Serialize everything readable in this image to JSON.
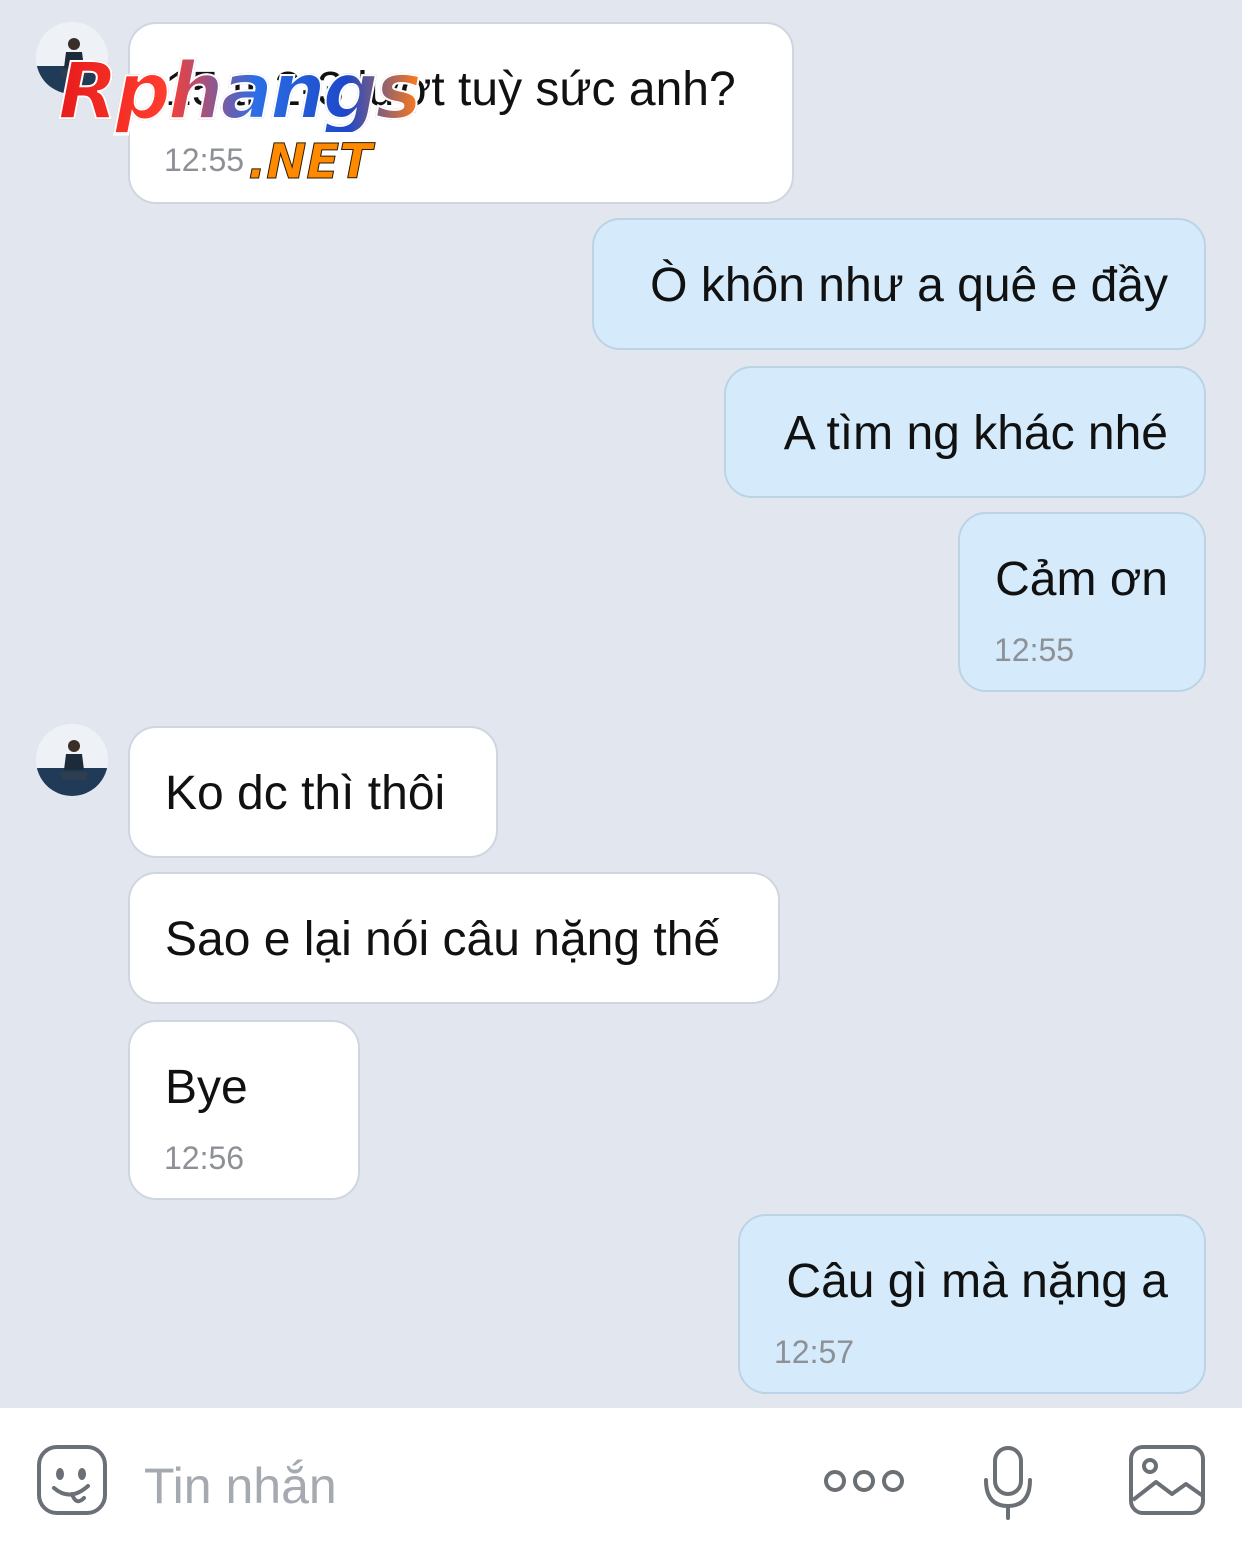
{
  "watermark": {
    "main": "Rphangs",
    "suffix": ".NET"
  },
  "messages": [
    {
      "side": "received",
      "text": "15 tr 2-3 lượt tuỳ sức anh?",
      "time": "12:55",
      "avatar": true
    },
    {
      "side": "sent",
      "text": "Ò khôn như a quê e đầy"
    },
    {
      "side": "sent",
      "text": "A tìm ng khác nhé"
    },
    {
      "side": "sent",
      "text": "Cảm ơn",
      "time": "12:55"
    },
    {
      "side": "received",
      "text": "Ko dc thì thôi",
      "avatar": true
    },
    {
      "side": "received",
      "text": "Sao e lại nói câu nặng thế"
    },
    {
      "side": "received",
      "text": "Bye",
      "time": "12:56"
    },
    {
      "side": "sent",
      "text": "Câu gì mà nặng a",
      "time": "12:57"
    }
  ],
  "composer": {
    "placeholder": "Tin nhắn",
    "icons": [
      "sticker-icon",
      "more-icon",
      "microphone-icon",
      "image-icon"
    ]
  },
  "colors": {
    "chat_background": "#e2e7ef",
    "received_bubble": "#ffffff",
    "sent_bubble": "#d5ebfb",
    "timestamp": "#8d9096"
  }
}
